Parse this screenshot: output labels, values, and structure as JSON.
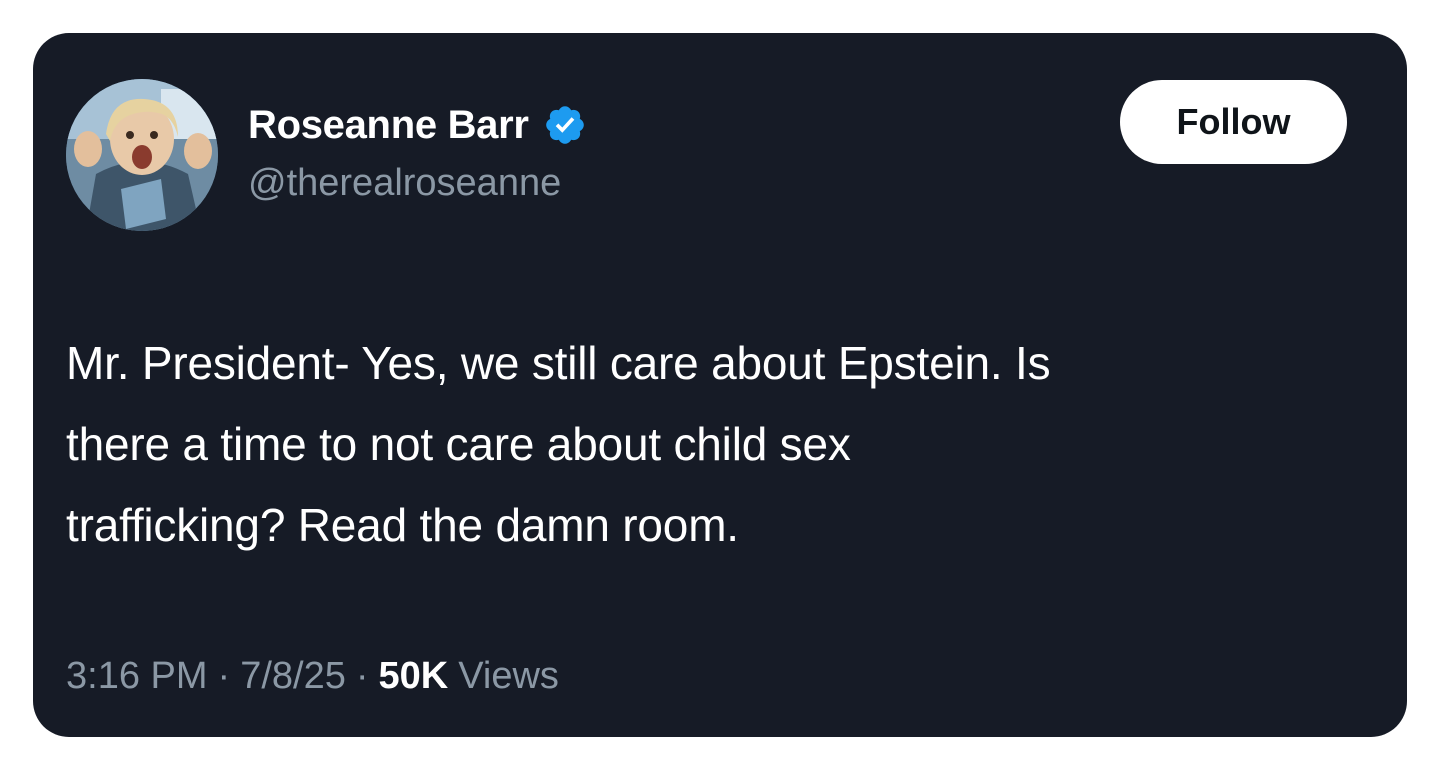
{
  "tweet": {
    "author": {
      "name": "Roseanne Barr",
      "handle": "@therealroseanne",
      "verified": true
    },
    "follow_label": "Follow",
    "text_lines": [
      "Mr. President- Yes, we still care about Epstein. Is",
      "there a time to not care about child sex",
      "trafficking? Read the damn room."
    ],
    "time": "3:16 PM",
    "separator": "·",
    "date": "7/8/25",
    "views_count": "50K",
    "views_label": "Views"
  },
  "colors": {
    "card_background": "#161b26",
    "text_primary": "#ffffff",
    "text_secondary": "#8b98a5",
    "verified_badge": "#1d9bf0",
    "follow_button_bg": "#ffffff",
    "follow_button_text": "#0f1419"
  },
  "icons": {
    "verified": "verified-badge-icon"
  }
}
